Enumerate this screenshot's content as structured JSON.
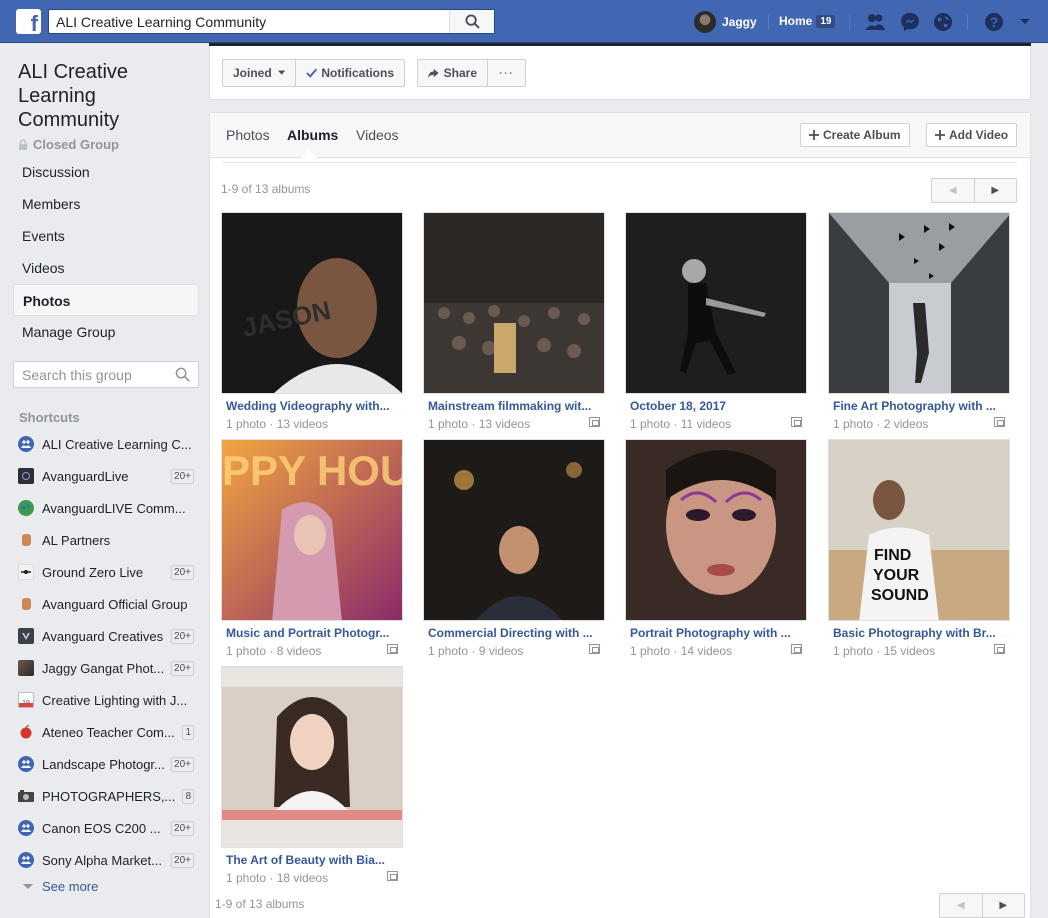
{
  "topbar": {
    "search_value": "ALI Creative Learning Community",
    "user_name": "Jaggy",
    "home_label": "Home",
    "home_count": "19"
  },
  "group": {
    "title": "ALI Creative Learning Community",
    "privacy": "Closed Group"
  },
  "nav": {
    "items": [
      {
        "label": "Discussion"
      },
      {
        "label": "Members"
      },
      {
        "label": "Events"
      },
      {
        "label": "Videos"
      },
      {
        "label": "Photos"
      },
      {
        "label": "Manage Group"
      }
    ],
    "search_placeholder": "Search this group"
  },
  "shortcuts": {
    "title": "Shortcuts",
    "items": [
      {
        "label": "ALI Creative Learning C...",
        "count": "",
        "icon": "group-icon"
      },
      {
        "label": "AvanguardLive",
        "count": "20+",
        "icon": "avanguard-icon"
      },
      {
        "label": "AvanguardLIVE Comm...",
        "count": "",
        "icon": "globe-icon"
      },
      {
        "label": "AL Partners",
        "count": "",
        "icon": "fist-icon"
      },
      {
        "label": "Ground Zero Live",
        "count": "20+",
        "icon": "ground-zero-icon"
      },
      {
        "label": "Avanguard Official Group",
        "count": "",
        "icon": "fist-icon"
      },
      {
        "label": "Avanguard Creatives",
        "count": "20+",
        "icon": "avanguard-v-icon"
      },
      {
        "label": "Jaggy Gangat Phot...",
        "count": "20+",
        "icon": "photo-avatar-icon"
      },
      {
        "label": "Creative Lighting with J...",
        "count": "",
        "icon": "calendar-icon"
      },
      {
        "label": "Ateneo Teacher Com...",
        "count": "1",
        "icon": "apple-icon"
      },
      {
        "label": "Landscape Photogr...",
        "count": "20+",
        "icon": "group-icon"
      },
      {
        "label": "PHOTOGRAPHERS,...",
        "count": "8",
        "icon": "camera-icon"
      },
      {
        "label": "Canon EOS C200 ...",
        "count": "20+",
        "icon": "group-icon"
      },
      {
        "label": "Sony Alpha Market...",
        "count": "20+",
        "icon": "group-icon"
      }
    ],
    "see_more": "See more"
  },
  "actions": {
    "joined": "Joined",
    "notifications": "Notifications",
    "share": "Share",
    "more": "···"
  },
  "tabs": {
    "photos": "Photos",
    "albums": "Albums",
    "videos": "Videos",
    "create_album": "Create Album",
    "add_video": "Add Video"
  },
  "albums_count": "1-9 of 13 albums",
  "albums": [
    {
      "name": "Wedding Videography with...",
      "meta": "1 photo · 13 videos",
      "bg": "#2a2a2a"
    },
    {
      "name": "Mainstream filmmaking wit...",
      "meta": "1 photo · 13 videos",
      "bg": "#3a3532"
    },
    {
      "name": "October 18, 2017",
      "meta": "1 photo · 11 videos",
      "bg": "#1b1b1b"
    },
    {
      "name": "Fine Art Photography with ...",
      "meta": "1 photo · 2 videos",
      "bg": "#8a8d90"
    },
    {
      "name": "Music and Portrait Photogr...",
      "meta": "1 photo · 8 videos",
      "bg": "#c8502e"
    },
    {
      "name": "Commercial Directing with ...",
      "meta": "1 photo · 9 videos",
      "bg": "#2a2420"
    },
    {
      "name": "Portrait Photography with ...",
      "meta": "1 photo · 14 videos",
      "bg": "#6b4a40"
    },
    {
      "name": "Basic Photography with Br...",
      "meta": "1 photo · 15 videos",
      "bg": "#c9c1b3"
    },
    {
      "name": "The Art of Beauty with Bia...",
      "meta": "1 photo · 18 videos",
      "bg": "#d8cfc6"
    }
  ]
}
